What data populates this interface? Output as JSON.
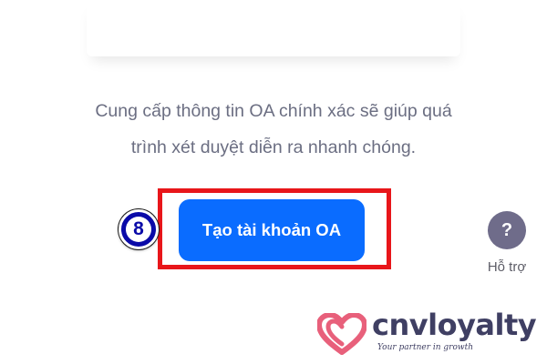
{
  "info": {
    "line1": "Cung cấp thông tin OA chính xác sẽ giúp quá",
    "line2": "trình xét duyệt diễn ra nhanh chóng."
  },
  "primary_button": {
    "label": "Tạo tài khoản OA"
  },
  "step_badge": {
    "number": "8"
  },
  "support": {
    "icon_glyph": "?",
    "label": "Hỗ trợ",
    "icon": "question-icon"
  },
  "watermark": {
    "brand": "cnvloyalty",
    "tagline": "Your partner in growth"
  },
  "colors": {
    "primary": "#0a6cff",
    "highlight": "#e8161a",
    "badge": "#0a0aa8",
    "help_icon_bg": "#6f6c8a",
    "text_gray": "#6b6e82",
    "logo_pink": "#e8607b",
    "logo_navy": "#3f3f63"
  }
}
